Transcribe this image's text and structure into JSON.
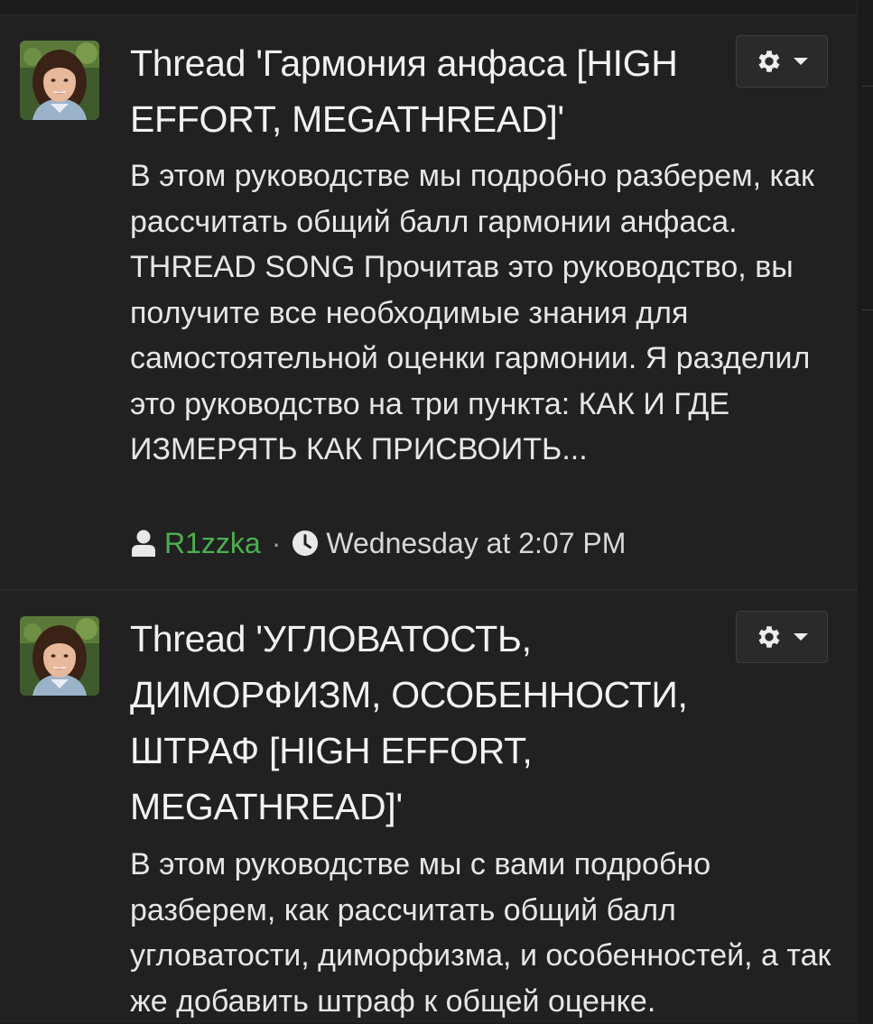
{
  "results": [
    {
      "title": "Thread 'Гармония анфаса [HIGH EFFORT, MEGATHREAD]'",
      "snippet": "В этом руководстве мы подробно разберем, как рассчитать общий балл гармонии анфаса. THREAD SONG Прочитав это руководство, вы получите все необходимые знания для самостоятельной оценки гармонии. Я разделил это руководство на три пункта: КАК И ГДЕ ИЗМЕРЯТЬ КАК ПРИСВОИТЬ...",
      "author": "R1zzka",
      "separator": "·",
      "date": "Wednesday at 2:07 PM",
      "avatar_icon": "user-avatar-photo",
      "options_icon": "gear-icon"
    },
    {
      "title": "Thread 'УГЛОВАТОСТЬ, ДИМОРФИЗМ, ОСОБЕННОСТИ, ШТРАФ [HIGH EFFORT, MEGATHREAD]'",
      "snippet": "В этом руководстве мы с вами подробно разберем, как рассчитать общий балл угловатости, диморфизма, и особенностей, а так же добавить штраф к общей оценке.",
      "avatar_icon": "user-avatar-photo",
      "options_icon": "gear-icon"
    }
  ],
  "colors": {
    "background": "#212121",
    "username": "#4caf50",
    "text": "#e6e6e6"
  }
}
